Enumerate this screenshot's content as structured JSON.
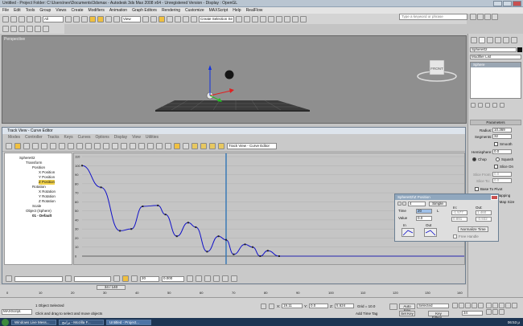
{
  "app": {
    "title": "Untitled   - Project Folder: C:\\Users\\nev\\Documents\\3dsmax   - Autodesk 3ds Max 2008 x64  - Unregistered Version   - Display : OpenGL"
  },
  "menubar": [
    "File",
    "Edit",
    "Tools",
    "Group",
    "Views",
    "Create",
    "Modifiers",
    "Animation",
    "Graph Editors",
    "Rendering",
    "Customize",
    "MAXScript",
    "Help",
    "RealFlow"
  ],
  "toolbar": {
    "selection_filter": "All",
    "ref_coord": "View",
    "named_selection": "Create Selection Se",
    "search_placeholder": "Type a keyword or phrase"
  },
  "viewport": {
    "label": "Perspective",
    "viewcube_label": "FRONT"
  },
  "command_panel": {
    "object_name": "Sphere02",
    "modifier_list": "Modifier List",
    "stack_item": "Sphere",
    "parameters_header": "Parameters",
    "radius_label": "Radius:",
    "radius_value": "10.369",
    "segments_label": "Segments:",
    "segments_value": "32",
    "smooth_label": "Smooth",
    "hemisphere_label": "Hemisphere:",
    "hemisphere_value": "0.0",
    "chop_label": "Chop",
    "squash_label": "Squash",
    "slice_on_label": "Slice On",
    "slice_from_label": "Slice From:",
    "slice_from_value": "0.0",
    "slice_to_label": "Slice To:",
    "slice_to_value": "0.0",
    "base_to_pivot_label": "Base To Pivot",
    "gen_mapping_label": "Generate Mapping Coords.",
    "real_world_label": "Real-World Map Size"
  },
  "trackview": {
    "title": "Track View - Curve Editor",
    "menu": [
      "Modes",
      "Controller",
      "Tracks",
      "Keys",
      "Curves",
      "Options",
      "Display",
      "View",
      "Utilities"
    ],
    "mode_dropdown": "Track View - Curve Editor",
    "tree": [
      "Sphere02",
      "Transform",
      "Position",
      "X Position",
      "Y Position",
      "Z Position",
      "Rotation",
      "X Rotation",
      "Y Rotation",
      "Z Rotation",
      "Scale",
      "Object (Sphere)",
      "01 - Default"
    ],
    "frame_field": "20",
    "value_field": "0.000"
  },
  "key_dialog": {
    "title": "Sphere02\\Z Position",
    "key_number": "4",
    "type_button": "Simple",
    "time_label": "Time",
    "time_value": "20",
    "value_label": "Value",
    "value_value": "0.0",
    "in_label": "In:",
    "out_label": "Out:",
    "in_value": "-1.577",
    "out_value": "1.460",
    "in_value2": "0.891",
    "out_value2": "-0.932",
    "lock_label": "L",
    "in_tangent_label": "In",
    "out_tangent_label": "Out",
    "normalize_button": "Normalize Time",
    "free_handle_label": "Free Handle"
  },
  "chart_data": {
    "type": "line",
    "title": "",
    "xlabel": "",
    "ylabel": "",
    "xlim": [
      0,
      100
    ],
    "ylim": [
      0,
      100
    ],
    "y_ticks": [
      0,
      10,
      20,
      30,
      40,
      50,
      60,
      70,
      80,
      90,
      100,
      110
    ],
    "series": [
      {
        "color": "#1010c8",
        "x": [
          0,
          5,
          10,
          13,
          16,
          20,
          22,
          25,
          28,
          30,
          33,
          36,
          38,
          40,
          43,
          45,
          47,
          49,
          52
        ],
        "values": [
          100,
          76,
          28,
          30,
          55,
          56,
          46,
          22,
          37,
          32,
          5,
          22,
          18,
          2,
          13,
          10,
          0,
          6,
          0
        ]
      }
    ],
    "time_slider": "34"
  },
  "timeline": {
    "frame_counter": "34 / 140",
    "ticks": [
      "0",
      "10",
      "20",
      "30",
      "40",
      "50",
      "60",
      "70",
      "80",
      "90",
      "100",
      "110",
      "120",
      "130",
      "140"
    ]
  },
  "statusbar": {
    "status": "1 Object Selected",
    "prompt": "Click and drag to select and move objects",
    "maxscript": "MAXScript.",
    "x_label": "X:",
    "x_value": "19.11",
    "y_label": "Y:",
    "y_value": "0.0",
    "z_label": "Z:",
    "z_value": "5.624",
    "grid": "Grid = 10.0",
    "add_time_tag": "Add Time Tag",
    "auto_key": "Auto Key",
    "set_key": "Set Key",
    "key_selection": "Selected",
    "key_filters": "Key Filters...",
    "current_frame": "34"
  },
  "taskbar": {
    "items": [
      "Windows Live Mess...",
      "برامج - Mozilla F...",
      "Untitled   - Project..."
    ],
    "clock": "06:53 μ"
  }
}
